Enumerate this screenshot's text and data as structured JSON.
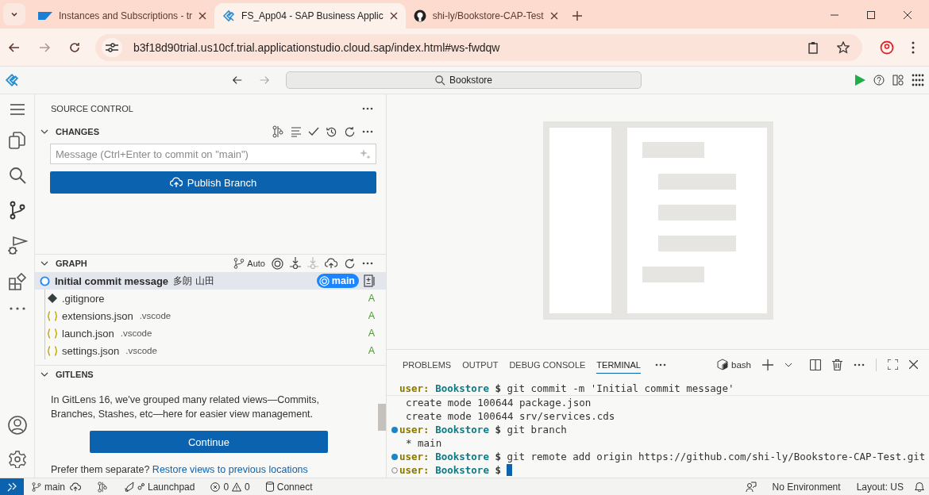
{
  "browser": {
    "tabs": [
      {
        "title": "Instances and Subscriptions - tr",
        "kind": "sap",
        "selected": false
      },
      {
        "title": "FS_App04 - SAP Business Applic",
        "kind": "bas",
        "selected": true
      },
      {
        "title": "shi-ly/Bookstore-CAP-Test",
        "kind": "github",
        "selected": false
      }
    ],
    "url": "b3f18d90trial.us10cf.trial.applicationstudio.cloud.sap/index.html#ws-fwdqw"
  },
  "header": {
    "search": "Bookstore"
  },
  "source_control": {
    "title": "SOURCE CONTROL",
    "changes": {
      "title": "CHANGES",
      "expanded": true,
      "placeholder": "Message (Ctrl+Enter to commit on \"main\")",
      "publish_button": "Publish Branch"
    },
    "graph": {
      "title": "GRAPH",
      "expanded": true,
      "auto_label": "Auto",
      "commit": {
        "message": "Initial commit message",
        "author": "多朗 山田",
        "branch": "main",
        "selected": true
      },
      "files": [
        {
          "name": ".gitignore",
          "kind": "git",
          "status": "A"
        },
        {
          "name": "extensions.json",
          "folder": ".vscode",
          "kind": "json",
          "status": "A"
        },
        {
          "name": "launch.json",
          "folder": ".vscode",
          "kind": "json",
          "status": "A"
        },
        {
          "name": "settings.json",
          "folder": ".vscode",
          "kind": "json",
          "status": "A"
        }
      ]
    },
    "gitlens": {
      "title": "GITLENS",
      "expanded": true,
      "text": "In GitLens 16, we've grouped many related views—Commits, Branches, Stashes, etc—here for easier view management.",
      "button": "Continue",
      "prompt": "Prefer them separate?",
      "link": "Restore views to previous locations"
    }
  },
  "panel": {
    "tabs": [
      {
        "label": "PROBLEMS",
        "selected": false
      },
      {
        "label": "OUTPUT",
        "selected": false
      },
      {
        "label": "DEBUG CONSOLE",
        "selected": false
      },
      {
        "label": "TERMINAL",
        "selected": true
      }
    ],
    "shell": "bash",
    "terminal": [
      {
        "kind": "command",
        "marker": false,
        "user": "user:",
        "dir": "Bookstore",
        "prompt": "$",
        "command": "git commit -m 'Initial commit message'"
      },
      {
        "kind": "output",
        "text": "create mode 100644 package.json"
      },
      {
        "kind": "output",
        "text": "create mode 100644 srv/services.cds"
      },
      {
        "kind": "command",
        "marker": true,
        "finished": true,
        "user": "user:",
        "dir": "Bookstore",
        "prompt": "$",
        "command": "git branch"
      },
      {
        "kind": "output",
        "text": "* main"
      },
      {
        "kind": "command",
        "marker": true,
        "finished": true,
        "user": "user:",
        "dir": "Bookstore",
        "prompt": "$",
        "command": "git remote add origin https://github.com/shi-ly/Bookstore-CAP-Test.git"
      },
      {
        "kind": "command",
        "marker": true,
        "finished": false,
        "user": "user:",
        "dir": "Bookstore",
        "prompt": "$",
        "cursor": true
      }
    ]
  },
  "status_bar": {
    "branch": "main",
    "launchpad": "Launchpad",
    "errors": "0",
    "warnings": "0",
    "connect": "Connect",
    "environment": "No Environment",
    "layout": "Layout: US"
  }
}
